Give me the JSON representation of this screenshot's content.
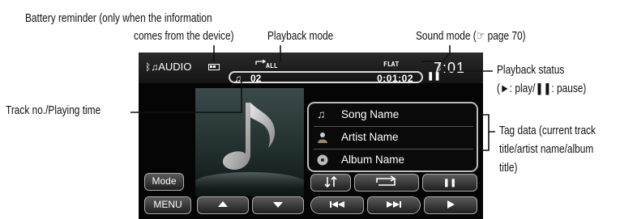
{
  "callouts": {
    "battery_reminder_line1": "Battery reminder (only when the information",
    "battery_reminder_line2": "comes from the device)",
    "playback_mode": "Playback mode",
    "sound_mode": "Sound mode (☞ page 70)",
    "playback_status_line1": "Playback status",
    "playback_status_line2": "(►: play/❚❚: pause)",
    "track_no_playing_time": "Track no./Playing time",
    "tag_data_line1": "Tag data (current track",
    "tag_data_line2": "title/artist name/album",
    "tag_data_line3": "title)"
  },
  "screen": {
    "source_label": "AUDIO",
    "playback_mode_label": "ALL",
    "sound_mode_label": "FLAT",
    "clock": "7:01",
    "track_number": "02",
    "playing_time": "0:01:02",
    "playback_status_icon": "pause-icon",
    "tags": {
      "song": "Song Name",
      "artist": "Artist Name",
      "album": "Album Name"
    },
    "buttons": {
      "mode": "Mode",
      "menu": "MENU"
    },
    "icons": [
      "bluetooth-icon",
      "music-note-icon",
      "battery-icon",
      "repeat-icon",
      "artist-icon",
      "album-disc-icon",
      "up-arrow-icon",
      "down-arrow-icon",
      "random-icon",
      "repeat-button-icon",
      "pause-icon",
      "previous-track-icon",
      "next-track-icon",
      "play-icon"
    ]
  },
  "colors": {
    "screen_bg": "#050505",
    "frame_outline": "#bbbbbb",
    "text_on_screen": "#ffffff"
  }
}
